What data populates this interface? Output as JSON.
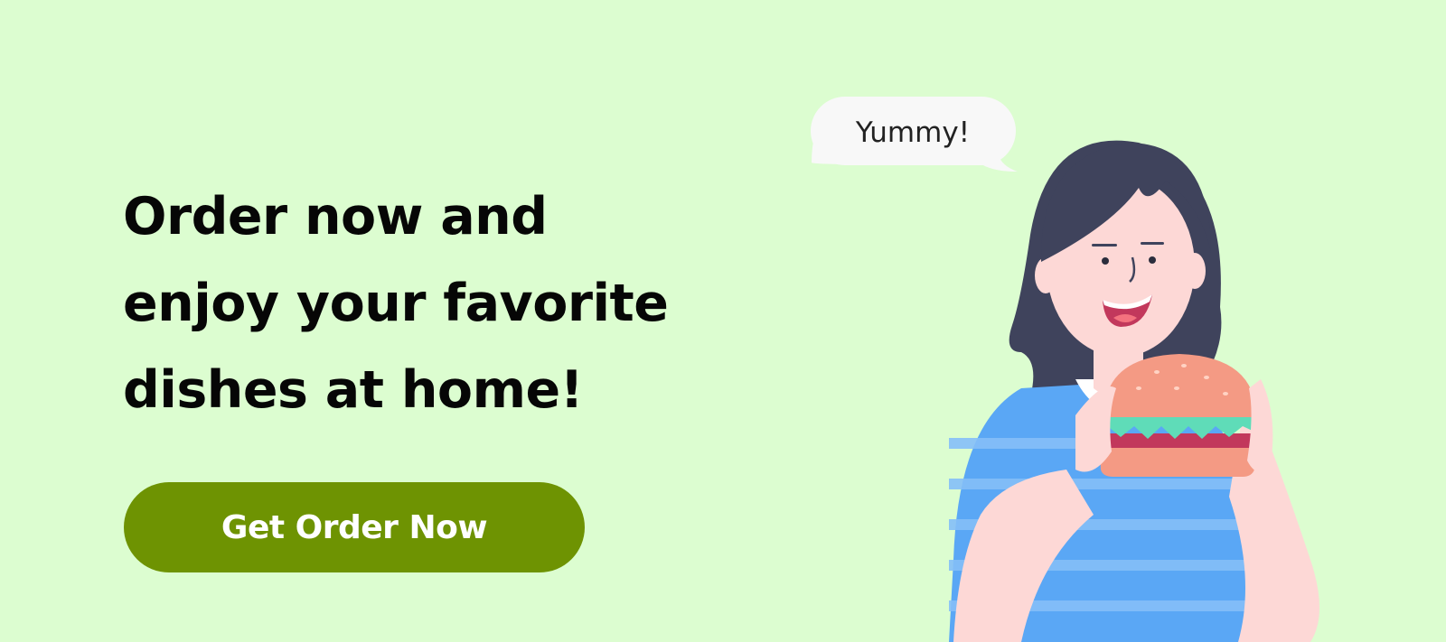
{
  "headline": {
    "line1": "Order now and",
    "line2": "enjoy your favorite",
    "line3": "dishes at home!"
  },
  "cta": {
    "label": "Get Order Now"
  },
  "speech_bubble": {
    "text": "Yummy!"
  },
  "colors": {
    "background": "#dcfdd0",
    "headline": "#060606",
    "button": "#6e9302",
    "button_text": "#ffffff",
    "hair": "#3f435c",
    "skin": "#fdd8d6",
    "shirt": "#5aa7f5",
    "burger_bun": "#f49a84",
    "lettuce": "#5fdcb8",
    "patty": "#c2385c"
  },
  "illustration": {
    "subject": "woman-eating-burger"
  }
}
